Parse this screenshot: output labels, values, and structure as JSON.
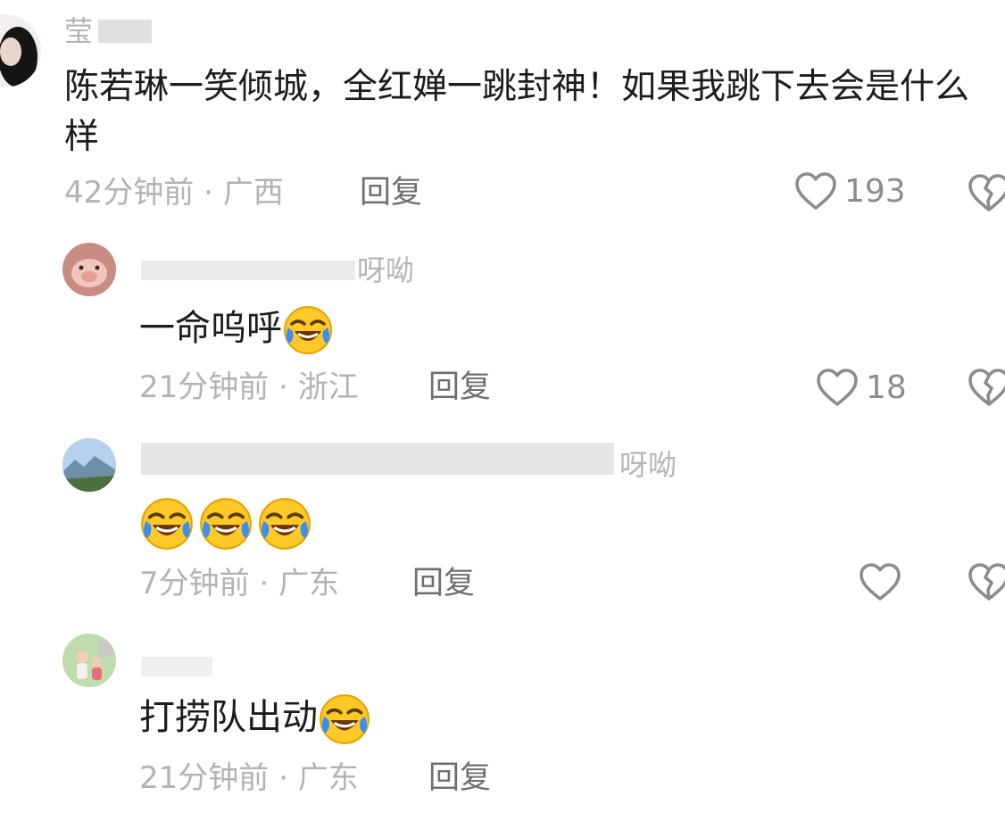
{
  "comments": [
    {
      "name": "莹",
      "text": "陈若琳一笑倾城，全红婵一跳封神！如果我跳下去会是什么样",
      "time": "42分钟前",
      "sep": "·",
      "location": "广西",
      "reply_label": "回复",
      "likes": "193"
    },
    {
      "name": "呀呦",
      "text": "一命呜呼",
      "emoji_count": 1,
      "time": "21分钟前",
      "sep": "·",
      "location": "浙江",
      "reply_label": "回复",
      "likes": "18"
    },
    {
      "name": "呀呦",
      "text": "",
      "emoji_count": 3,
      "time": "7分钟前",
      "sep": "·",
      "location": "广东",
      "reply_label": "回复",
      "likes": ""
    },
    {
      "name": "",
      "text": "打捞队出动",
      "emoji_count": 1,
      "time": "21分钟前",
      "sep": "·",
      "location": "广东",
      "reply_label": "回复"
    }
  ],
  "icons": {
    "like": "heart-outline-icon",
    "dislike": "broken-heart-icon",
    "emoji": "laughing-crying-emoji"
  },
  "colors": {
    "text": "#1c1c1c",
    "meta": "#b3b3b3",
    "reply": "#6f6f6f",
    "icon": "#8c8c8c"
  }
}
